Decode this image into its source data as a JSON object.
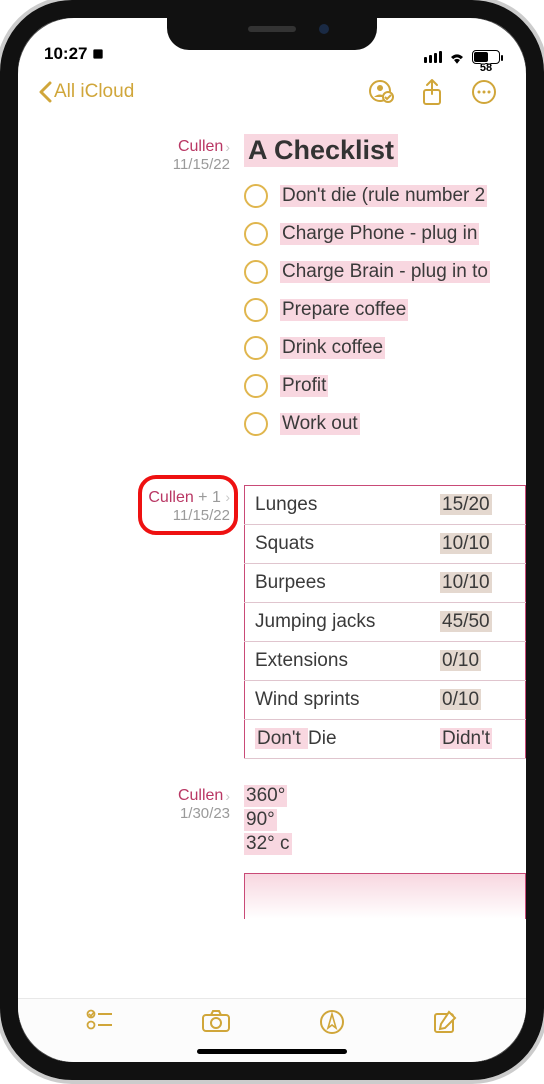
{
  "status": {
    "time": "10:27",
    "battery_pct": "58"
  },
  "nav": {
    "back_label": "All iCloud"
  },
  "sections": [
    {
      "attribution": {
        "name": "Cullen",
        "plus": "",
        "date": "11/15/22",
        "highlighted": false
      },
      "title": "A Checklist",
      "checklist": [
        "Don't die (rule number 2",
        "Charge Phone - plug in ",
        "Charge Brain - plug in to",
        "Prepare coffee",
        "Drink coffee",
        "Profit",
        "Work out"
      ]
    },
    {
      "attribution": {
        "name": "Cullen",
        "plus": " + 1",
        "date": "11/15/22",
        "highlighted": true
      },
      "table": [
        {
          "label": "Lunges",
          "value": "15/20",
          "label_hl": false
        },
        {
          "label": "Squats",
          "value": "10/10",
          "label_hl": false
        },
        {
          "label": "Burpees",
          "value": "10/10",
          "label_hl": false
        },
        {
          "label": "Jumping jacks",
          "value": "45/50",
          "label_hl": false
        },
        {
          "label": "Extensions",
          "value": "0/10",
          "label_hl": false
        },
        {
          "label": "Wind sprints",
          "value": "0/10",
          "label_hl": false
        },
        {
          "label_pre": "Don't ",
          "label_post": "Die",
          "value": "Didn't",
          "label_hl": true
        }
      ]
    },
    {
      "attribution": {
        "name": "Cullen",
        "plus": "",
        "date": "1/30/23",
        "highlighted": false
      },
      "degrees": [
        "360°",
        "90°",
        "32° c"
      ]
    }
  ]
}
